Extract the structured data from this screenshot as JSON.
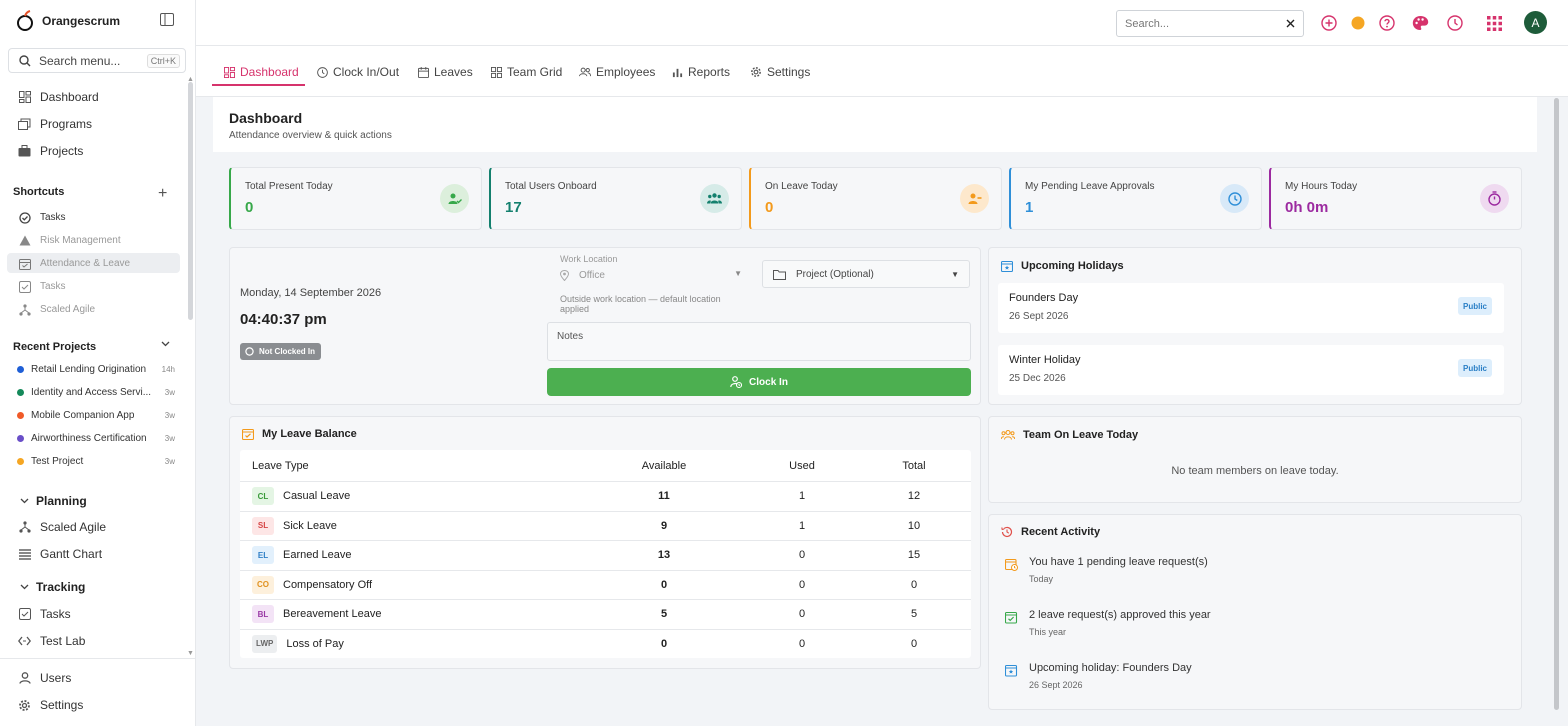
{
  "app": {
    "name": "Orangescrum"
  },
  "sidebar": {
    "search_placeholder": "Search menu...",
    "search_shortcut": "Ctrl+K",
    "nav": [
      {
        "label": "Dashboard",
        "icon": "dashboard-icon"
      },
      {
        "label": "Programs",
        "icon": "programs-icon"
      },
      {
        "label": "Projects",
        "icon": "briefcase-icon"
      }
    ],
    "shortcuts_title": "Shortcuts",
    "shortcuts": [
      {
        "label": "Tasks",
        "icon": "check-circle-icon"
      },
      {
        "label": "Risk Management",
        "icon": "warning-triangle-icon"
      },
      {
        "label": "Attendance & Leave",
        "icon": "calendar-check-icon"
      },
      {
        "label": "Tasks",
        "icon": "checkbox-icon"
      },
      {
        "label": "Scaled Agile",
        "icon": "hierarchy-icon"
      }
    ],
    "recent_title": "Recent Projects",
    "recent_projects": [
      {
        "name": "Retail Lending Origination",
        "age": "14h",
        "color": "#1f5fd6"
      },
      {
        "name": "Identity and Access Servi...",
        "age": "3w",
        "color": "#14895a"
      },
      {
        "name": "Mobile Companion App",
        "age": "3w",
        "color": "#f05a28"
      },
      {
        "name": "Airworthiness Certification",
        "age": "3w",
        "color": "#6a4fc8"
      },
      {
        "name": "Test Project",
        "age": "3w",
        "color": "#f5a623"
      }
    ],
    "groups": [
      {
        "title": "Planning",
        "items": [
          {
            "label": "Scaled Agile",
            "icon": "hierarchy-icon"
          },
          {
            "label": "Gantt Chart",
            "icon": "gantt-icon"
          }
        ]
      },
      {
        "title": "Tracking",
        "items": [
          {
            "label": "Tasks",
            "icon": "checkbox-icon"
          },
          {
            "label": "Test Lab",
            "icon": "code-icon"
          }
        ]
      }
    ],
    "footer": [
      {
        "label": "Users",
        "icon": "user-icon"
      },
      {
        "label": "Settings",
        "icon": "gear-icon"
      }
    ]
  },
  "topbar": {
    "search_placeholder": "Search...",
    "avatar_letter": "A"
  },
  "tabs": [
    {
      "label": "Dashboard",
      "icon": "dashboard-icon",
      "active": true
    },
    {
      "label": "Clock In/Out",
      "icon": "clock-icon",
      "active": false
    },
    {
      "label": "Leaves",
      "icon": "calendar-icon",
      "active": false
    },
    {
      "label": "Team Grid",
      "icon": "grid-icon",
      "active": false
    },
    {
      "label": "Employees",
      "icon": "people-icon",
      "active": false
    },
    {
      "label": "Reports",
      "icon": "bar-chart-icon",
      "active": false
    },
    {
      "label": "Settings",
      "icon": "gear-icon",
      "active": false
    }
  ],
  "page": {
    "title": "Dashboard",
    "subtitle": "Attendance overview & quick actions"
  },
  "stats": [
    {
      "label": "Total Present Today",
      "value": "0",
      "color": "#37a84a",
      "icon": "user-check-icon"
    },
    {
      "label": "Total Users Onboard",
      "value": "17",
      "color": "#14806e",
      "icon": "users-icon"
    },
    {
      "label": "On Leave Today",
      "value": "0",
      "color": "#f39a1c",
      "icon": "user-minus-icon"
    },
    {
      "label": "My Pending Leave Approvals",
      "value": "1",
      "color": "#2f8fd8",
      "icon": "clock-icon"
    },
    {
      "label": "My Hours Today",
      "value": "0h 0m",
      "color": "#9c2aa0",
      "icon": "stopwatch-icon"
    }
  ],
  "clock": {
    "date": "Monday, 14 September 2026",
    "time": "04:40:37 pm",
    "status": "Not Clocked In",
    "work_location_label": "Work Location",
    "work_location_value": "Office",
    "project_placeholder": "Project (Optional)",
    "location_note": "Outside work location — default location applied",
    "notes_placeholder": "Notes",
    "button_label": "Clock In"
  },
  "holidays": {
    "title": "Upcoming Holidays",
    "items": [
      {
        "name": "Founders Day",
        "date": "26 Sept 2026",
        "type": "Public"
      },
      {
        "name": "Winter Holiday",
        "date": "25 Dec 2026",
        "type": "Public"
      }
    ]
  },
  "leave_balance": {
    "title": "My Leave Balance",
    "columns": [
      "Leave Type",
      "Available",
      "Used",
      "Total"
    ],
    "rows": [
      {
        "code": "CL",
        "type": "Casual Leave",
        "available": "11",
        "used": "1",
        "total": "12",
        "bg": "#e4f5e4",
        "fg": "#3a9a3a"
      },
      {
        "code": "SL",
        "type": "Sick Leave",
        "available": "9",
        "used": "1",
        "total": "10",
        "bg": "#fde6e6",
        "fg": "#d64545"
      },
      {
        "code": "EL",
        "type": "Earned Leave",
        "available": "13",
        "used": "0",
        "total": "15",
        "bg": "#e2f0fc",
        "fg": "#2f7fc6"
      },
      {
        "code": "CO",
        "type": "Compensatory Off",
        "available": "0",
        "used": "0",
        "total": "0",
        "bg": "#fdf0dc",
        "fg": "#e0911f"
      },
      {
        "code": "BL",
        "type": "Bereavement Leave",
        "available": "5",
        "used": "0",
        "total": "5",
        "bg": "#f3e3f6",
        "fg": "#9a3aa6"
      },
      {
        "code": "LWP",
        "type": "Loss of Pay",
        "available": "0",
        "used": "0",
        "total": "0",
        "bg": "#eceef0",
        "fg": "#666666"
      }
    ]
  },
  "team_leave": {
    "title": "Team On Leave Today",
    "empty": "No team members on leave today."
  },
  "activity": {
    "title": "Recent Activity",
    "items": [
      {
        "text": "You have 1 pending leave request(s)",
        "sub": "Today",
        "color": "#f39a1c",
        "icon": "calendar-clock-icon"
      },
      {
        "text": "2 leave request(s) approved this year",
        "sub": "This year",
        "color": "#37a84a",
        "icon": "calendar-check-icon"
      },
      {
        "text": "Upcoming holiday: Founders Day",
        "sub": "26 Sept 2026",
        "color": "#2f8fd8",
        "icon": "calendar-star-icon"
      }
    ]
  }
}
